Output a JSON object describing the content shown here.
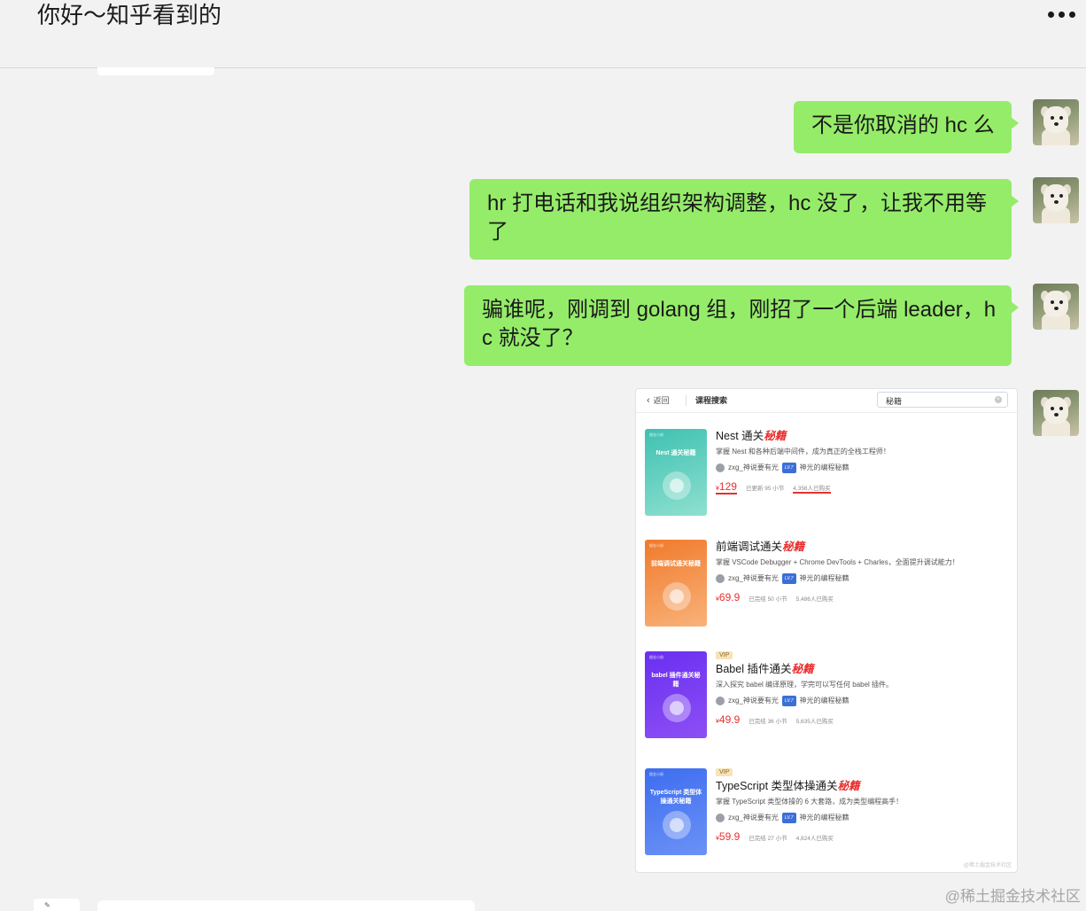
{
  "chat": {
    "title": "你好～知乎看到的"
  },
  "messages": [
    {
      "id": "m1",
      "text": "不是你取消的 hc 么"
    },
    {
      "id": "m2",
      "text": "hr 打电话和我说组织架构调整，hc 没了，让我不用等了"
    },
    {
      "id": "m3",
      "text": "骗谁呢，刚调到 golang 组，刚招了一个后端 leader，hc 就没了？"
    }
  ],
  "screenshot": {
    "back_label": "返回",
    "page_title": "课程搜索",
    "search_value": "秘籍",
    "watermark": "@稀土掘金技术社区",
    "courses": [
      {
        "cover_label": "Nest 通关秘籍",
        "cover_tag": "掘金小册",
        "cover_color_top": "#3ec1b2",
        "cover_color_bottom": "#8fe0cf",
        "vip": "",
        "title_plain": "Nest 通关",
        "title_em": "秘籍",
        "desc": "掌握 Nest 和各种后端中间件，成为真正的全栈工程师！",
        "author": "zxg_神说要有光",
        "level": "LV.7",
        "column": "神光的编程秘籍",
        "price_symbol": "¥",
        "price": "129",
        "updates": "已更新 95 小节",
        "buyers": "4,356人已购买"
      },
      {
        "cover_label": "前端调试通关秘籍",
        "cover_tag": "掘金小册",
        "cover_color_top": "#f07a2b",
        "cover_color_bottom": "#f9b27a",
        "vip": "",
        "title_plain": "前端调试通关",
        "title_em": "秘籍",
        "desc": "掌握 VSCode Debugger + Chrome DevTools + Charles，全面提升调试能力！",
        "author": "zxg_神说要有光",
        "level": "LV.7",
        "column": "神光的编程秘籍",
        "price_symbol": "¥",
        "price": "69.9",
        "updates": "已完结 50 小节",
        "buyers": "5,486人已购买"
      },
      {
        "cover_label": "babel 插件通关秘籍",
        "cover_tag": "掘金小册",
        "cover_color_top": "#6a2ff0",
        "cover_color_bottom": "#8c4ff5",
        "vip": "VIP",
        "title_plain": "Babel 插件通关",
        "title_em": "秘籍",
        "desc": "深入探究 babel 编译原理，学完可以写任何 babel 插件。",
        "author": "zxg_神说要有光",
        "level": "LV.7",
        "column": "神光的编程秘籍",
        "price_symbol": "¥",
        "price": "49.9",
        "updates": "已完结 36 小节",
        "buyers": "5,635人已购买"
      },
      {
        "cover_label": "TypeScript 类型体操通关秘籍",
        "cover_tag": "掘金小册",
        "cover_color_top": "#3d6df0",
        "cover_color_bottom": "#6c92f6",
        "vip": "VIP",
        "title_plain": "TypeScript 类型体操通关",
        "title_em": "秘籍",
        "desc": "掌握 TypeScript 类型体操的 6 大套路，成为类型编程高手！",
        "author": "zxg_神说要有光",
        "level": "LV.7",
        "column": "神光的编程秘籍",
        "price_symbol": "¥",
        "price": "59.9",
        "updates": "已完结 27 小节",
        "buyers": "4,824人已购买"
      }
    ]
  },
  "footer": {
    "watermark": "@稀土掘金技术社区"
  },
  "colors": {
    "bubble_self": "#95ec69",
    "background": "#f2f2f2",
    "price_red": "#e8302f"
  }
}
